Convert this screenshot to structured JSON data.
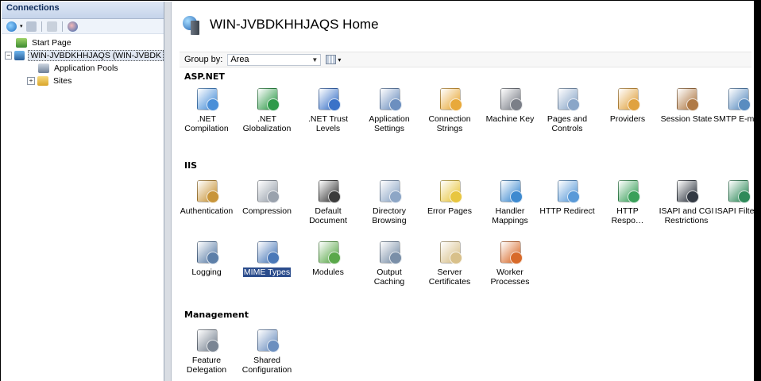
{
  "connections": {
    "title": "Connections",
    "tree": [
      {
        "label": "Start Page",
        "icon": "start-page-icon",
        "indent": 0
      },
      {
        "label": "WIN-JVBDKHHJAQS (WIN-JVBDK",
        "icon": "server-icon",
        "toggle": "−",
        "selected": true
      },
      {
        "label": "Application Pools",
        "icon": "app-pools-icon"
      },
      {
        "label": "Sites",
        "icon": "sites-folder-icon",
        "toggle": "+"
      }
    ]
  },
  "home": {
    "title": "WIN-JVBDKHHJAQS Home",
    "group_by_label": "Group by:",
    "group_by_value": "Area"
  },
  "sections": {
    "aspnet": "ASP.NET",
    "iis": "IIS",
    "management": "Management"
  },
  "aspnet_features": [
    {
      "l1": ".NET",
      "l2": "Compilation",
      "icon": "net-compilation-icon",
      "color": "#4a8fd8"
    },
    {
      "l1": ".NET",
      "l2": "Globalization",
      "icon": "globe-icon",
      "color": "#2f9a4a"
    },
    {
      "l1": ".NET Trust",
      "l2": "Levels",
      "icon": "trust-levels-icon",
      "color": "#3a72c8"
    },
    {
      "l1": "Application",
      "l2": "Settings",
      "icon": "app-settings-icon",
      "color": "#6c8fbf"
    },
    {
      "l1": "Connection",
      "l2": "Strings",
      "icon": "connection-strings-icon",
      "color": "#e8a93a"
    },
    {
      "l1": "Machine Key",
      "l2": "",
      "icon": "machine-key-icon",
      "color": "#7b7f88"
    },
    {
      "l1": "Pages and",
      "l2": "Controls",
      "icon": "pages-controls-icon",
      "color": "#8aa6c8"
    },
    {
      "l1": "Providers",
      "l2": "",
      "icon": "providers-icon",
      "color": "#e0a240"
    },
    {
      "l1": "Session State",
      "l2": "",
      "icon": "session-state-icon",
      "color": "#b07a46"
    },
    {
      "l1": "SMTP E-mail",
      "l2": "",
      "icon": "smtp-email-icon",
      "color": "#5a8cc0"
    }
  ],
  "iis_features_row1": [
    {
      "l1": "Authentication",
      "l2": "",
      "icon": "authentication-icon",
      "color": "#c8953a"
    },
    {
      "l1": "Compression",
      "l2": "",
      "icon": "compression-icon",
      "color": "#9aa2ad"
    },
    {
      "l1": "Default",
      "l2": "Document",
      "icon": "default-document-icon",
      "color": "#3b3b3b"
    },
    {
      "l1": "Directory",
      "l2": "Browsing",
      "icon": "directory-browsing-icon",
      "color": "#8da6c6"
    },
    {
      "l1": "Error Pages",
      "l2": "",
      "icon": "error-pages-icon",
      "color": "#e8c640"
    },
    {
      "l1": "Handler",
      "l2": "Mappings",
      "icon": "handler-mappings-icon",
      "color": "#3e8ad0"
    },
    {
      "l1": "HTTP Redirect",
      "l2": "",
      "icon": "http-redirect-icon",
      "color": "#5a9ad8"
    },
    {
      "l1": "HTTP",
      "l2": "Respo…",
      "icon": "http-response-icon",
      "color": "#3aa05a"
    },
    {
      "l1": "ISAPI and CGI",
      "l2": "Restrictions",
      "icon": "isapi-cgi-icon",
      "color": "#333a44"
    },
    {
      "l1": "ISAPI Filters",
      "l2": "",
      "icon": "isapi-filters-icon",
      "color": "#2f8a5a"
    }
  ],
  "iis_features_row2": [
    {
      "l1": "Logging",
      "l2": "",
      "icon": "logging-icon",
      "color": "#5d7fa8"
    },
    {
      "l1": "MIME Types",
      "l2": "",
      "icon": "mime-types-icon",
      "color": "#4a78b8",
      "selected": true
    },
    {
      "l1": "Modules",
      "l2": "",
      "icon": "modules-icon",
      "color": "#5aa84a"
    },
    {
      "l1": "Output",
      "l2": "Caching",
      "icon": "output-caching-icon",
      "color": "#7a8fa8"
    },
    {
      "l1": "Server",
      "l2": "Certificates",
      "icon": "server-certificates-icon",
      "color": "#d8c08a"
    },
    {
      "l1": "Worker",
      "l2": "Processes",
      "icon": "worker-processes-icon",
      "color": "#d86a2a"
    }
  ],
  "management_features": [
    {
      "l1": "Feature",
      "l2": "Delegation",
      "icon": "feature-delegation-icon",
      "color": "#7a8593"
    },
    {
      "l1": "Shared",
      "l2": "Configuration",
      "icon": "shared-configuration-icon",
      "color": "#6c8fbf"
    }
  ]
}
